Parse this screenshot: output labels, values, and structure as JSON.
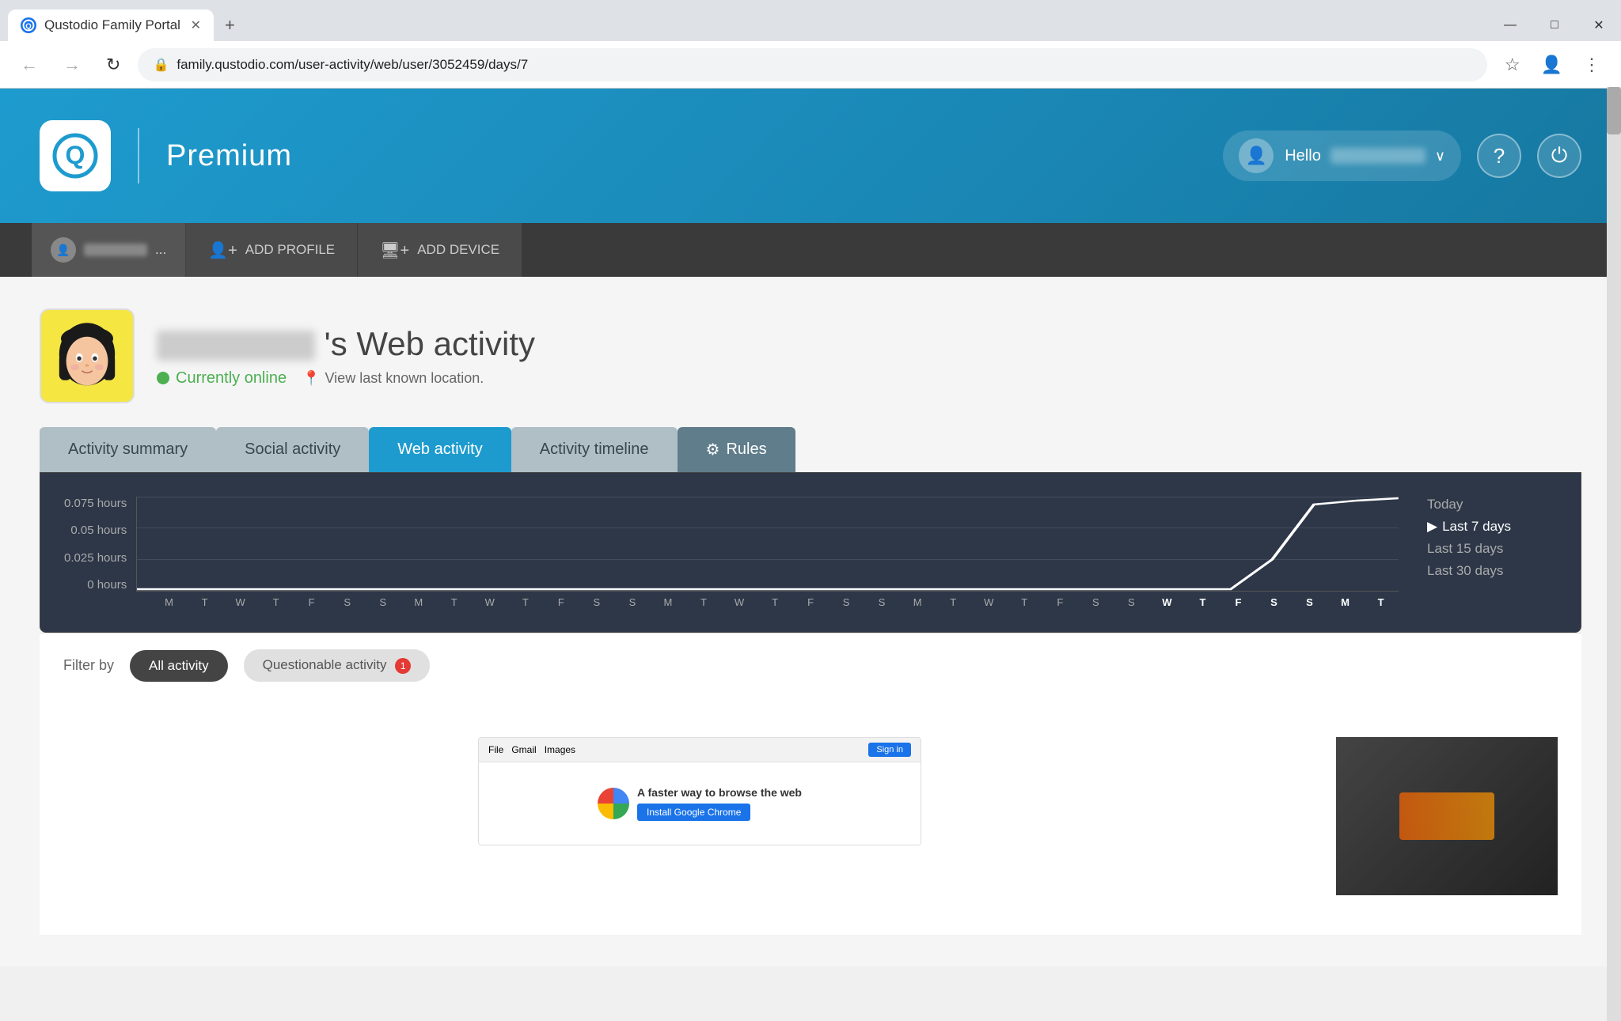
{
  "browser": {
    "tab_title": "Qustodio Family Portal",
    "url": "family.qustodio.com/user-activity/web/user/3052459/days/7",
    "favicon_letter": "Q"
  },
  "header": {
    "logo_text": "Qustodio",
    "plan_text": "Premium",
    "hello_text": "Hello",
    "user_display": "[redacted]",
    "help_icon": "?",
    "power_icon": "⏻"
  },
  "profile_bar": {
    "profile_name": "[redacted]",
    "ellipsis": "...",
    "add_profile_label": "ADD PROFILE",
    "add_device_label": "ADD DEVICE"
  },
  "child": {
    "name_display": "[redacted]",
    "page_title": "'s Web activity",
    "online_status": "Currently online",
    "location_text": "View last known location."
  },
  "tabs": [
    {
      "id": "activity-summary",
      "label": "Activity summary",
      "state": "inactive"
    },
    {
      "id": "social-activity",
      "label": "Social activity",
      "state": "inactive"
    },
    {
      "id": "web-activity",
      "label": "Web activity",
      "state": "active"
    },
    {
      "id": "activity-timeline",
      "label": "Activity timeline",
      "state": "inactive"
    },
    {
      "id": "rules",
      "label": "Rules",
      "state": "rules"
    }
  ],
  "chart": {
    "y_labels": [
      "0.075 hours",
      "0.05 hours",
      "0.025 hours",
      "0 hours"
    ],
    "x_labels": [
      "M",
      "T",
      "W",
      "T",
      "F",
      "S",
      "S",
      "M",
      "T",
      "W",
      "T",
      "F",
      "S",
      "S",
      "M",
      "T",
      "W",
      "T",
      "F",
      "S",
      "S",
      "M",
      "T",
      "W",
      "T",
      "F",
      "S",
      "S",
      "M",
      "T"
    ],
    "bold_labels": [
      "W",
      "T",
      "F",
      "S",
      "S",
      "M",
      "T"
    ],
    "period_options": [
      {
        "id": "today",
        "label": "Today",
        "selected": false
      },
      {
        "id": "last-7",
        "label": "Last 7 days",
        "selected": true
      },
      {
        "id": "last-15",
        "label": "Last 15 days",
        "selected": false
      },
      {
        "id": "last-30",
        "label": "Last 30 days",
        "selected": false
      }
    ]
  },
  "filter": {
    "label": "Filter by",
    "all_activity_label": "All activity",
    "questionable_label": "Questionable activity",
    "badge_count": "1"
  },
  "icons": {
    "back": "←",
    "forward": "→",
    "refresh": "↻",
    "lock": "🔒",
    "bookmark": "☆",
    "user": "👤",
    "menu": "⋮",
    "minimize": "—",
    "maximize": "□",
    "close": "✕",
    "gear": "⚙",
    "arrow_right": "▶",
    "chevron_down": "∨",
    "map_pin": "📍",
    "person": "👤",
    "monitor": "🖥"
  }
}
